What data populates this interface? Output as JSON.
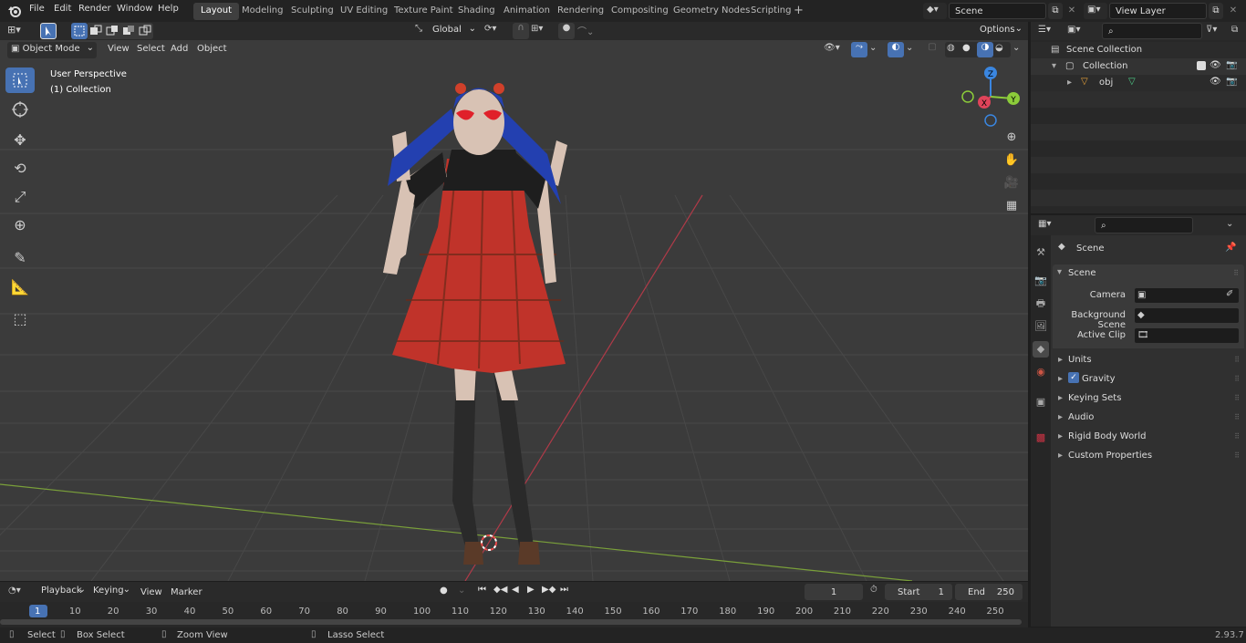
{
  "topbar": {
    "menus": [
      "File",
      "Edit",
      "Render",
      "Window",
      "Help"
    ],
    "workspaces": [
      "Layout",
      "Modeling",
      "Sculpting",
      "UV Editing",
      "Texture Paint",
      "Shading",
      "Animation",
      "Rendering",
      "Compositing",
      "Geometry Nodes",
      "Scripting"
    ],
    "active_workspace": "Layout",
    "add_tab": "+",
    "scene_name": "Scene",
    "view_layer": "View Layer"
  },
  "viewport_header": {
    "mode": "Object Mode",
    "menus": [
      "View",
      "Select",
      "Add",
      "Object"
    ],
    "orientation": "Global",
    "options": "Options"
  },
  "viewport": {
    "perspective": "User Perspective",
    "collection": "(1) Collection",
    "gizmo_axes": {
      "z": "Z",
      "y": "Y",
      "x": "X"
    }
  },
  "outliner": {
    "search_placeholder": "",
    "rows": [
      {
        "label": "Scene Collection"
      },
      {
        "label": "Collection"
      },
      {
        "label": "obj"
      }
    ]
  },
  "properties": {
    "context": "Scene",
    "panel": "Scene",
    "fields": [
      {
        "label": "Camera",
        "value": ""
      },
      {
        "label": "Background Scene",
        "value": ""
      },
      {
        "label": "Active Clip",
        "value": ""
      }
    ],
    "sections": [
      "Units",
      "Gravity",
      "Keying Sets",
      "Audio",
      "Rigid Body World",
      "Custom Properties"
    ]
  },
  "timeline": {
    "menus": [
      "Playback",
      "Keying",
      "View",
      "Marker"
    ],
    "current_frame": "1",
    "start_label": "Start",
    "start": "1",
    "end_label": "End",
    "end": "250",
    "ticks": [
      "1",
      "10",
      "20",
      "30",
      "40",
      "50",
      "60",
      "70",
      "80",
      "90",
      "100",
      "110",
      "120",
      "130",
      "140",
      "150",
      "160",
      "170",
      "180",
      "190",
      "200",
      "210",
      "220",
      "230",
      "240",
      "250"
    ]
  },
  "statusbar": {
    "items": [
      "Select",
      "Box Select",
      "Zoom View",
      "Lasso Select"
    ],
    "version": "2.93.7"
  },
  "colors": {
    "accent": "#4772b3",
    "x_axis": "#e0445a",
    "y_axis": "#8ccc3a",
    "z_axis": "#3a86e0",
    "viewport_bg": "#3b3b3b",
    "panel_bg": "#303030"
  }
}
